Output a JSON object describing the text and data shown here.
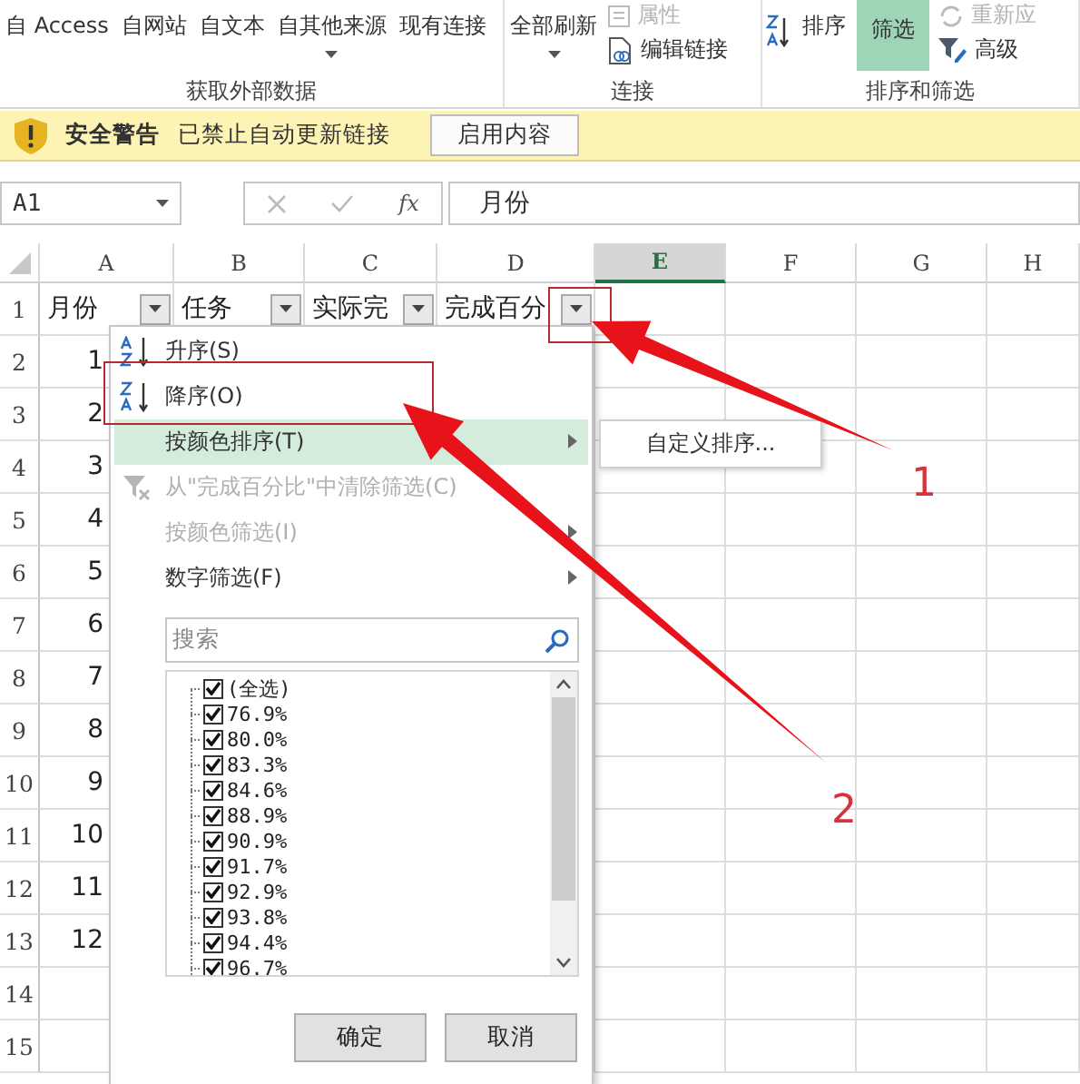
{
  "ribbon": {
    "groups": [
      {
        "label": "获取外部数据",
        "columns": [
          [
            {
              "label": "自 Access",
              "kind": "large",
              "disabled": false,
              "selected": false
            }
          ],
          [
            {
              "label": "自网站",
              "kind": "large",
              "disabled": false,
              "selected": false
            }
          ],
          [
            {
              "label": "自文本",
              "kind": "large",
              "disabled": false,
              "selected": false
            }
          ],
          [
            {
              "label": "自其他来源",
              "kind": "dropdown",
              "disabled": false,
              "selected": false
            }
          ],
          [
            {
              "label": "现有连接",
              "kind": "large",
              "disabled": false,
              "selected": false
            }
          ]
        ]
      },
      {
        "label": "连接",
        "columns": [
          [
            {
              "label": "全部刷新",
              "kind": "dropdown",
              "disabled": false,
              "selected": false
            }
          ],
          [
            {
              "label": "属性",
              "kind": "properties",
              "disabled": true,
              "selected": false
            },
            {
              "label": "编辑链接",
              "kind": "links",
              "disabled": false,
              "selected": false
            }
          ]
        ]
      },
      {
        "label": "排序和筛选",
        "columns": [
          [
            {
              "kind": "sort_icon",
              "disabled": false,
              "selected": false
            }
          ],
          [
            {
              "label": "排序",
              "kind": "large",
              "disabled": false,
              "selected": false
            }
          ],
          [
            {
              "label": "筛选",
              "kind": "large",
              "disabled": false,
              "selected": true
            }
          ],
          [
            {
              "label": "重新应",
              "kind": "reapply",
              "disabled": true,
              "selected": false
            },
            {
              "label": "高级",
              "kind": "advanced",
              "disabled": false,
              "selected": false
            }
          ]
        ]
      }
    ]
  },
  "security_bar": {
    "title": "安全警告",
    "message": "已禁止自动更新链接",
    "button": "启用内容"
  },
  "formula_bar": {
    "name_box": "A1",
    "function_label": "fx",
    "formula": "月份"
  },
  "columns": [
    {
      "label": "A",
      "selected": false
    },
    {
      "label": "B",
      "selected": false
    },
    {
      "label": "C",
      "selected": false
    },
    {
      "label": "D",
      "selected": false
    },
    {
      "label": "E",
      "selected": true
    },
    {
      "label": "F",
      "selected": false
    },
    {
      "label": "G",
      "selected": false
    },
    {
      "label": "H",
      "selected": false
    }
  ],
  "rows": [
    {
      "number": "1",
      "cells": [
        {
          "text": "月份",
          "filter": true
        },
        {
          "text": "任务",
          "filter": true
        },
        {
          "text": "实际完",
          "filter": true
        },
        {
          "text": "完成百分",
          "filter": true
        }
      ]
    },
    {
      "number": "2",
      "cells": [
        {
          "text": "1",
          "filter": false
        }
      ]
    },
    {
      "number": "3",
      "cells": [
        {
          "text": "2",
          "filter": false
        }
      ]
    },
    {
      "number": "4",
      "cells": [
        {
          "text": "3",
          "filter": false
        }
      ]
    },
    {
      "number": "5",
      "cells": [
        {
          "text": "4",
          "filter": false
        }
      ]
    },
    {
      "number": "6",
      "cells": [
        {
          "text": "5",
          "filter": false
        }
      ]
    },
    {
      "number": "7",
      "cells": [
        {
          "text": "6",
          "filter": false
        }
      ]
    },
    {
      "number": "8",
      "cells": [
        {
          "text": "7",
          "filter": false
        }
      ]
    },
    {
      "number": "9",
      "cells": [
        {
          "text": "8",
          "filter": false
        }
      ]
    },
    {
      "number": "10",
      "cells": [
        {
          "text": "9",
          "filter": false
        }
      ]
    },
    {
      "number": "11",
      "cells": [
        {
          "text": "10",
          "filter": false
        }
      ]
    },
    {
      "number": "12",
      "cells": [
        {
          "text": "11",
          "filter": false
        }
      ]
    },
    {
      "number": "13",
      "cells": [
        {
          "text": "12",
          "filter": false
        }
      ]
    },
    {
      "number": "14",
      "cells": []
    },
    {
      "number": "15",
      "cells": []
    }
  ],
  "filter_menu": {
    "items": [
      {
        "label": "升序(S)",
        "kind": "ascending",
        "disabled": false,
        "highlighted": false,
        "submenu": false
      },
      {
        "label": "降序(O)",
        "kind": "descending",
        "disabled": false,
        "highlighted": false,
        "submenu": false
      },
      {
        "label": "按颜色排序(T)",
        "kind": "plain",
        "disabled": false,
        "highlighted": true,
        "submenu": true
      },
      {
        "label": "从\"完成百分比\"中清除筛选(C)",
        "kind": "clear",
        "disabled": true,
        "highlighted": false,
        "submenu": false
      },
      {
        "label": "按颜色筛选(I)",
        "kind": "plain",
        "disabled": true,
        "highlighted": false,
        "submenu": true
      },
      {
        "label": "数字筛选(F)",
        "kind": "plain",
        "disabled": false,
        "highlighted": false,
        "submenu": true
      }
    ],
    "submenu": {
      "label": "自定义排序..."
    },
    "search": {
      "placeholder": "搜索"
    },
    "values": [
      {
        "label": "(全选)",
        "checked": true
      },
      {
        "label": "76.9%",
        "checked": true
      },
      {
        "label": "80.0%",
        "checked": true
      },
      {
        "label": "83.3%",
        "checked": true
      },
      {
        "label": "84.6%",
        "checked": true
      },
      {
        "label": "88.9%",
        "checked": true
      },
      {
        "label": "90.9%",
        "checked": true
      },
      {
        "label": "91.7%",
        "checked": true
      },
      {
        "label": "92.9%",
        "checked": true
      },
      {
        "label": "93.8%",
        "checked": true
      },
      {
        "label": "94.4%",
        "checked": true
      },
      {
        "label": "96.7%",
        "checked": true
      }
    ],
    "buttons": [
      "确定",
      "取消"
    ]
  },
  "annotations": [
    {
      "label": "1"
    },
    {
      "label": "2"
    }
  ]
}
